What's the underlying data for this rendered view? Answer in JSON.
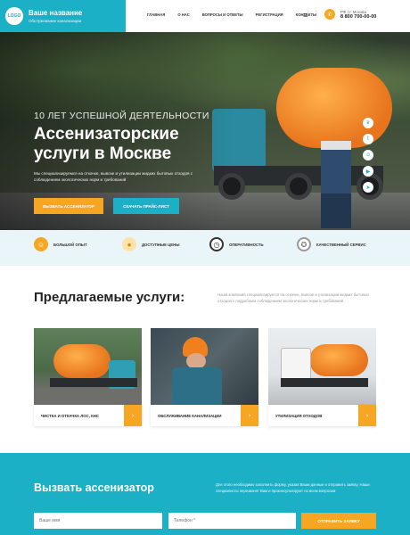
{
  "header": {
    "logo_text": "LOGO",
    "site_name": "Ваше название",
    "site_tagline": "Обслуживание канализации",
    "nav": [
      "Главная",
      "О нас",
      "Вопросы и ответы",
      "Регистрация",
      "Контакты"
    ],
    "menu_icon": "hamburger-icon",
    "phone_icon": "phone-icon",
    "city": "РФ | г. Москва",
    "phone": "8 800 700-00-00"
  },
  "hero": {
    "kicker": "10 лет успешной деятельности",
    "title": "Ассенизаторские услуги в Москве",
    "text": "Мы специализируемся на откачке, вывозе и утилизации жидких бытовых отходов с соблюдением экологических норм и требований",
    "primary_button": "Вызвать ассенизатор",
    "secondary_button": "Скачать прайс-лист",
    "socials": [
      "vk-icon",
      "twitter-icon",
      "odnoklassniki-icon",
      "youtube-icon",
      "telegram-icon"
    ]
  },
  "features": [
    {
      "icon": "worker-icon",
      "label": "Большой опыт"
    },
    {
      "icon": "coins-icon",
      "label": "Доступные цены"
    },
    {
      "icon": "clock-icon",
      "label": "Оперативность"
    },
    {
      "icon": "award-icon",
      "label": "Качественный сервис"
    }
  ],
  "services": {
    "title": "Предлагаемые услуги:",
    "description": "Наша компания специализируется на откачке, вывозе и утилизации жидких бытовых отходов с подробным соблюдением экологических норм и требований",
    "cards": [
      {
        "label": "Чистка и откачка ЛОС, КНС"
      },
      {
        "label": "Обслуживание канализации"
      },
      {
        "label": "Утилизация отходов"
      }
    ],
    "arrow_icon": "chevron-right-icon"
  },
  "call": {
    "title": "Вызвать ассенизатор",
    "text": "Для этого необходимо заполнить форму, указав Ваши данные и отправить заявку. Наши специалисты перезвонят Вам и проконсультируют по всем вопросам",
    "name_placeholder": "Ваше имя",
    "phone_placeholder": "Телефон *",
    "submit": "Отправить заявку"
  },
  "colors": {
    "accent_teal": "#1bb0c6",
    "accent_orange": "#f6a623"
  }
}
